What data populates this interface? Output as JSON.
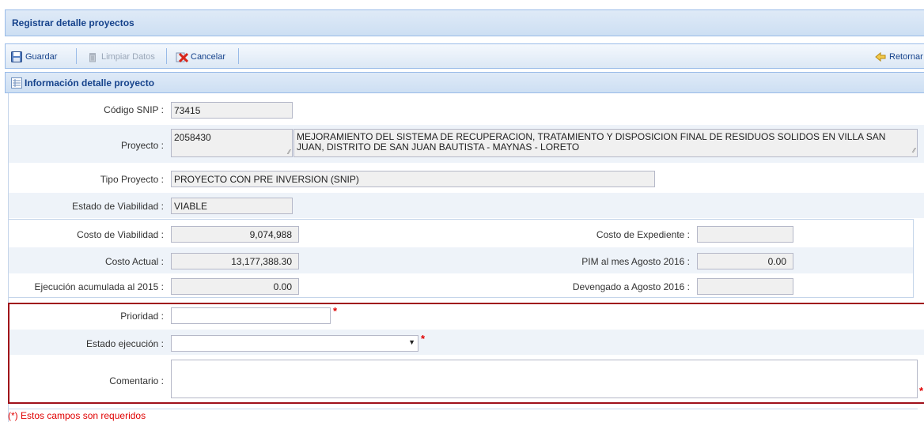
{
  "window": {
    "title": "Registrar detalle proyectos"
  },
  "toolbar": {
    "guardar": "Guardar",
    "limpiar": "Limpiar Datos",
    "cancelar": "Cancelar",
    "retornar": "Retornar"
  },
  "section": {
    "title": "Información detalle proyecto"
  },
  "form": {
    "codigo_snip": {
      "label": "Código SNIP :",
      "value": "73415"
    },
    "proyecto": {
      "label": "Proyecto :",
      "code": "2058430",
      "description": "MEJORAMIENTO DEL SISTEMA DE RECUPERACION, TRATAMIENTO Y DISPOSICION FINAL DE RESIDUOS SOLIDOS EN VILLA SAN JUAN, DISTRITO DE SAN JUAN BAUTISTA - MAYNAS - LORETO"
    },
    "tipo_proyecto": {
      "label": "Tipo Proyecto :",
      "value": "PROYECTO CON PRE INVERSION (SNIP)"
    },
    "estado_viabilidad": {
      "label": "Estado de Viabilidad :",
      "value": "VIABLE"
    },
    "costo_viabilidad": {
      "label": "Costo de Viabilidad :",
      "value": "9,074,988"
    },
    "costo_actual": {
      "label": "Costo Actual :",
      "value": "13,177,388.30"
    },
    "ejecucion_acumulada": {
      "label": "Ejecución acumulada al 2015 :",
      "value": "0.00"
    },
    "costo_expediente": {
      "label": "Costo de Expediente :",
      "value": ""
    },
    "pim": {
      "label": "PIM al mes Agosto 2016 :",
      "value": "0.00"
    },
    "devengado": {
      "label": "Devengado a Agosto 2016 :",
      "value": ""
    },
    "prioridad": {
      "label": "Prioridad :",
      "value": ""
    },
    "estado_ejecucion": {
      "label": "Estado ejecución :",
      "value": ""
    },
    "comentario": {
      "label": "Comentario :",
      "value": ""
    },
    "required_mark": "*"
  },
  "footnote": "(*) Estos campos son requeridos",
  "colors": {
    "accent": "#15428b",
    "border": "#99bbe8",
    "required": "#e00000",
    "highlight_box": "#a0101a"
  }
}
